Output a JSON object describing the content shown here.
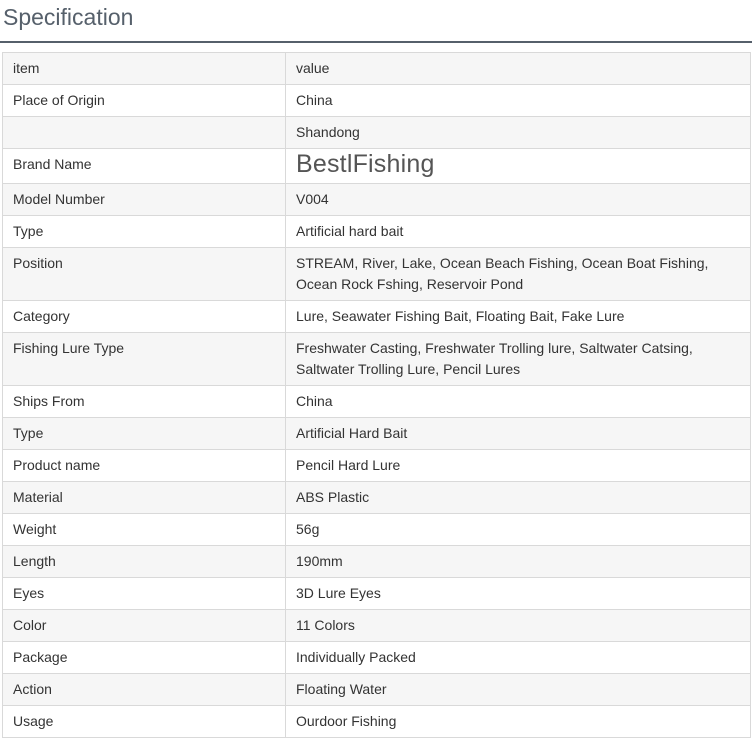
{
  "page": {
    "title": "Specification"
  },
  "table": {
    "header": {
      "item": "item",
      "value": "value"
    },
    "rows": [
      {
        "item": "Place of Origin",
        "value": "China"
      },
      {
        "item": "",
        "value": "Shandong"
      },
      {
        "item": "Brand Name",
        "value": "BestlFishing"
      },
      {
        "item": "Model Number",
        "value": "V004"
      },
      {
        "item": "Type",
        "value": "Artificial hard bait"
      },
      {
        "item": "Position",
        "value": "STREAM, River, Lake, Ocean Beach Fishing, Ocean Boat Fishing, Ocean Rock Fshing, Reservoir Pond"
      },
      {
        "item": "Category",
        "value": "Lure, Seawater Fishing Bait, Floating Bait, Fake Lure"
      },
      {
        "item": "Fishing Lure Type",
        "value": "Freshwater Casting, Freshwater Trolling lure, Saltwater Catsing, Saltwater Trolling Lure, Pencil Lures"
      },
      {
        "item": "Ships From",
        "value": "China"
      },
      {
        "item": "Type",
        "value": "Artificial Hard Bait"
      },
      {
        "item": "Product name",
        "value": "Pencil Hard Lure"
      },
      {
        "item": "Material",
        "value": "ABS Plastic"
      },
      {
        "item": "Weight",
        "value": "56g"
      },
      {
        "item": "Length",
        "value": "190mm"
      },
      {
        "item": "Eyes",
        "value": "3D Lure Eyes"
      },
      {
        "item": "Color",
        "value": "11 Colors"
      },
      {
        "item": "Package",
        "value": "Individually Packed"
      },
      {
        "item": "Action",
        "value": "Floating Water"
      },
      {
        "item": "Usage",
        "value": "Ourdoor Fishing"
      }
    ]
  }
}
